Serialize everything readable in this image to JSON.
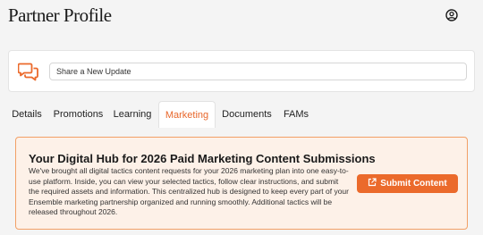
{
  "header": {
    "title": "Partner Profile",
    "user_icon": "user-circle-icon"
  },
  "update": {
    "icon": "chat-bubbles-icon",
    "placeholder": "Share a New Update"
  },
  "tabs": [
    {
      "label": "Details",
      "active": false
    },
    {
      "label": "Promotions",
      "active": false
    },
    {
      "label": "Learning",
      "active": false
    },
    {
      "label": "Marketing",
      "active": true
    },
    {
      "label": "Documents",
      "active": false
    },
    {
      "label": "FAMs",
      "active": false
    }
  ],
  "hub": {
    "title": "Your Digital Hub for 2026 Paid Marketing Content Submissions",
    "body": "We've brought all digital tactics content requests for your 2026 marketing plan into one easy-to-use platform. Inside, you can view your selected tactics, follow clear instructions, and submit the required assets and information. This centralized hub is designed to keep every part of your Ensemble marketing partnership organized and running smoothly. Additional tactics will be released throughout 2026.",
    "button_label": "Submit Content",
    "button_icon": "external-link-icon"
  },
  "colors": {
    "accent": "#eb6a2b",
    "hub_background": "#fdf1e8",
    "hub_border": "#f2a066"
  }
}
